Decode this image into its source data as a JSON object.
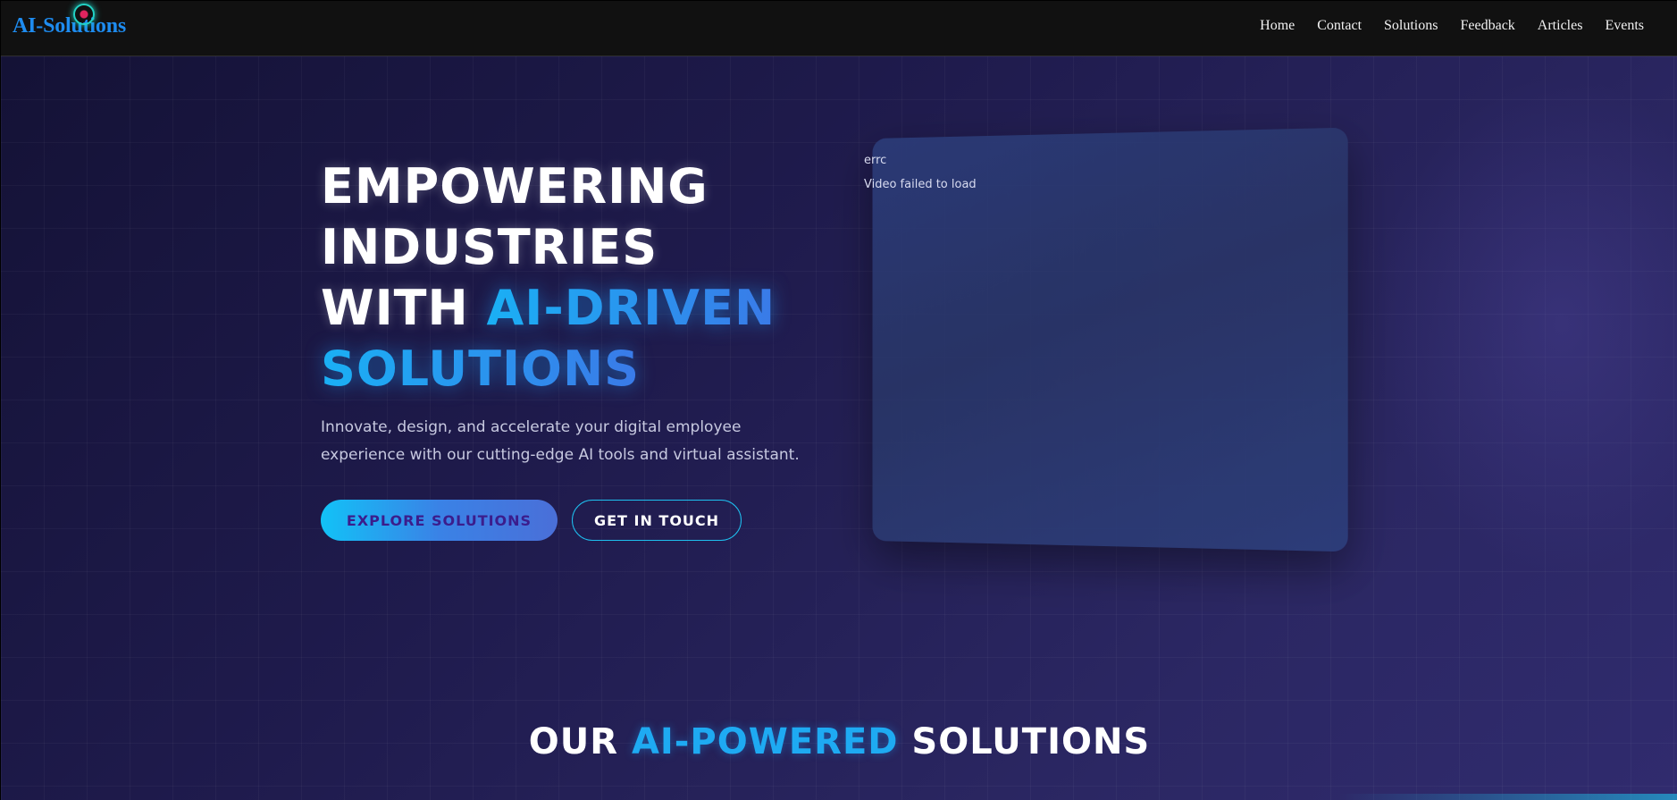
{
  "nav": {
    "logo": "AI-Solutions",
    "links": [
      "Home",
      "Contact",
      "Solutions",
      "Feedback",
      "Articles",
      "Events"
    ]
  },
  "hero": {
    "title_line1": "EMPOWERING",
    "title_line2": "INDUSTRIES",
    "title_line3_plain": "WITH ",
    "title_line3_accent": "AI-DRIVEN",
    "title_line4_accent": "SOLUTIONS",
    "subtitle": "Innovate, design, and accelerate your digital employee experience with our cutting-edge AI tools and virtual assistant.",
    "primary_button": "EXPLORE SOLUTIONS",
    "secondary_button": "GET IN TOUCH"
  },
  "video": {
    "alt_text": "errc",
    "error_text": "Video failed to load"
  },
  "section": {
    "title_before": "OUR ",
    "title_accent": "AI-POWERED",
    "title_after": " SOLUTIONS"
  },
  "colors": {
    "accent": "#1eaaf2",
    "logo": "#1e8cf0",
    "navbar_bg": "#111111"
  }
}
